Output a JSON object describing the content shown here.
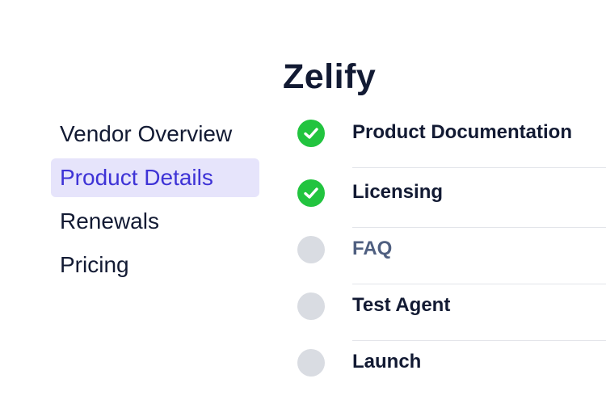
{
  "app": {
    "title": "Zelify"
  },
  "sidebar": {
    "items": [
      {
        "label": "Vendor Overview",
        "active": false
      },
      {
        "label": "Product Details",
        "active": true
      },
      {
        "label": "Renewals",
        "active": false
      },
      {
        "label": "Pricing",
        "active": false
      }
    ]
  },
  "steps": [
    {
      "label": "Product Documentation",
      "status": "complete"
    },
    {
      "label": "Licensing",
      "status": "complete"
    },
    {
      "label": "FAQ",
      "status": "current"
    },
    {
      "label": "Test Agent",
      "status": "pending"
    },
    {
      "label": "Launch",
      "status": "pending"
    }
  ],
  "colors": {
    "accent": "#3e33d6",
    "active_bg": "#e6e4fb",
    "complete": "#22c43f",
    "pending": "#d9dce2",
    "text": "#121a33",
    "current_text": "#4f5f80"
  }
}
